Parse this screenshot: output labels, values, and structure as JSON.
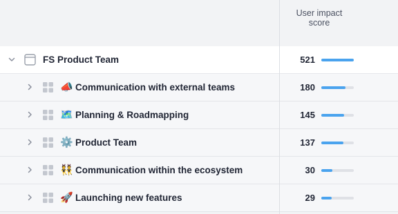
{
  "column": {
    "title_line1": "User impact",
    "title_line2": "score"
  },
  "team": {
    "name": "FS Product Team",
    "score": "521",
    "bar_fraction": 1.0,
    "icon": "folder-icon",
    "chevron": "chevron-down-icon"
  },
  "rows": [
    {
      "emoji": "📣",
      "name": "Communication with external teams",
      "score": "180",
      "bar_fraction": 0.75
    },
    {
      "emoji": "🗺️",
      "name": "Planning & Roadmapping",
      "score": "145",
      "bar_fraction": 0.7
    },
    {
      "emoji": "⚙️",
      "name": "Product Team",
      "score": "137",
      "bar_fraction": 0.68
    },
    {
      "emoji": "👯",
      "name": "Communication within the ecosystem",
      "score": "30",
      "bar_fraction": 0.33
    },
    {
      "emoji": "🚀",
      "name": "Launching new features",
      "score": "29",
      "bar_fraction": 0.32
    }
  ],
  "colors": {
    "bar": "#4aa3ee",
    "track": "#dfe1e6"
  }
}
